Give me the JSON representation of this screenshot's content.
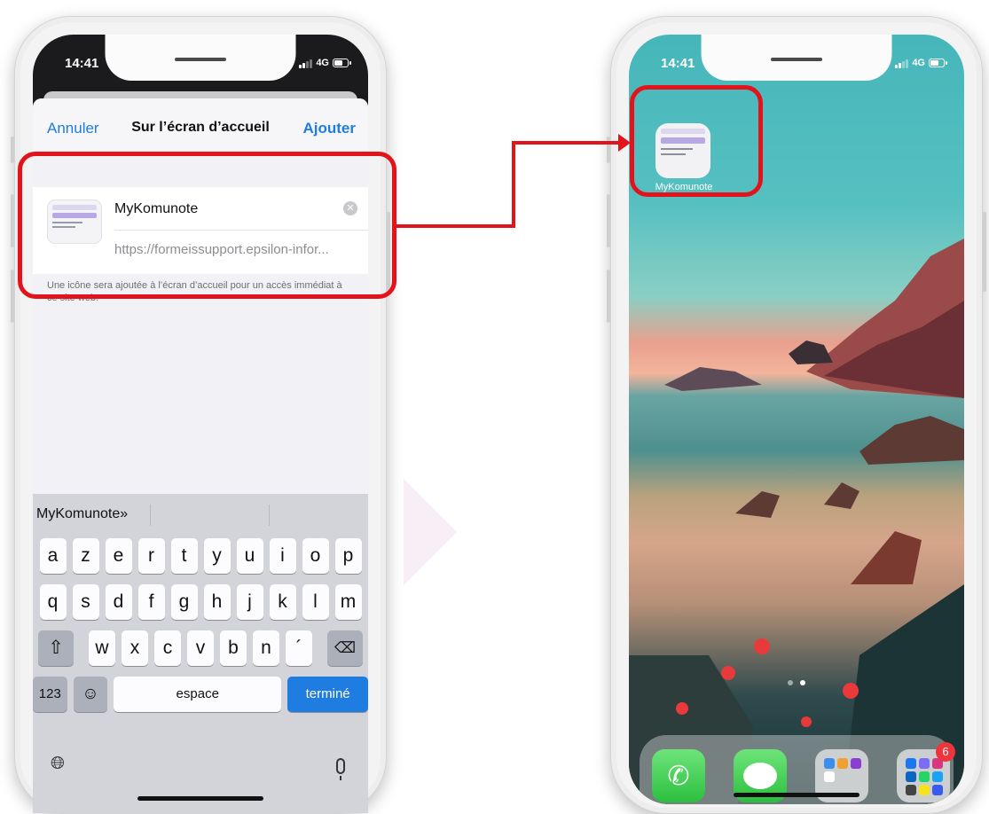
{
  "left_phone": {
    "status": {
      "time": "14:41",
      "network": "4G"
    },
    "navbar": {
      "cancel": "Annuler",
      "title": "Sur l’écran d’accueil",
      "add": "Ajouter"
    },
    "shortcut": {
      "name": "MyKomunote",
      "url": "https://formeissupport.epsilon-infor...",
      "hint": "Une icône sera ajoutée à l’écran d’accueil pour un accès immédiat à ce site web."
    },
    "keyboard": {
      "suggestion": "MyKomunote»",
      "row1": [
        "a",
        "z",
        "e",
        "r",
        "t",
        "y",
        "u",
        "i",
        "o",
        "p"
      ],
      "row2": [
        "q",
        "s",
        "d",
        "f",
        "g",
        "h",
        "j",
        "k",
        "l",
        "m"
      ],
      "row3": [
        "w",
        "x",
        "c",
        "v",
        "b",
        "n",
        "´"
      ],
      "numbers": "123",
      "space": "espace",
      "done": "terminé"
    }
  },
  "right_phone": {
    "status": {
      "time": "14:41",
      "network": "4G"
    },
    "app": {
      "label": "MyKomunote"
    },
    "dock": {
      "social_badge": "6"
    }
  },
  "colors": {
    "accent_blue": "#1f7ce0",
    "highlight_red": "#e3131b"
  }
}
